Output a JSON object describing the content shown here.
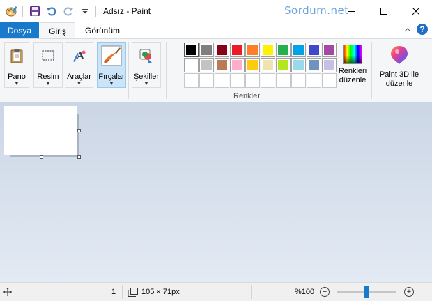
{
  "window": {
    "title": "Adsız - Paint",
    "watermark": "Sordum.net",
    "minimize_icon": "minimize-icon",
    "maximize_icon": "maximize-icon",
    "close_icon": "close-icon"
  },
  "quick_access": {
    "app_icon": "paint-palette-icon",
    "save_icon": "save-icon",
    "undo_icon": "undo-icon",
    "redo_icon": "redo-icon",
    "customize_icon": "chevron-down-icon"
  },
  "tabs": [
    {
      "label": "Dosya"
    },
    {
      "label": "Giriş"
    },
    {
      "label": "Görünüm"
    }
  ],
  "ribbon": {
    "collapse_icon": "chevron-up-icon",
    "help_label": "?",
    "groups": {
      "pano": "Pano",
      "resim": "Resim",
      "araclar": "Araçlar",
      "fircalar": "Fırçalar",
      "sekiller": "Şekiller"
    },
    "colors_label": "Renkler",
    "edit_colors_line1": "Renkleri",
    "edit_colors_line2": "düzenle",
    "paint3d_line1": "Paint 3D ile",
    "paint3d_line2": "düzenle",
    "palette_row1": [
      "#000000",
      "#7f7f7f",
      "#880015",
      "#ed1c24",
      "#ff7f27",
      "#fff200",
      "#22b14c",
      "#00a2e8",
      "#3f48cc",
      "#a349a4"
    ],
    "palette_row2": [
      "#ffffff",
      "#c3c3c3",
      "#b97a57",
      "#ffaec9",
      "#ffc90e",
      "#efe4b0",
      "#b5e61d",
      "#99d9ea",
      "#7092be",
      "#c8bfe7"
    ]
  },
  "status": {
    "cursor_icon": "move-cursor-icon",
    "selection_count": "1",
    "canvas_size_icon": "canvas-size-icon",
    "canvas_size": "105 × 71px",
    "zoom": "%100",
    "zoom_out_label": "−",
    "zoom_in_label": "+",
    "zoom_fraction": 0.5
  },
  "accent": "#1979ca"
}
